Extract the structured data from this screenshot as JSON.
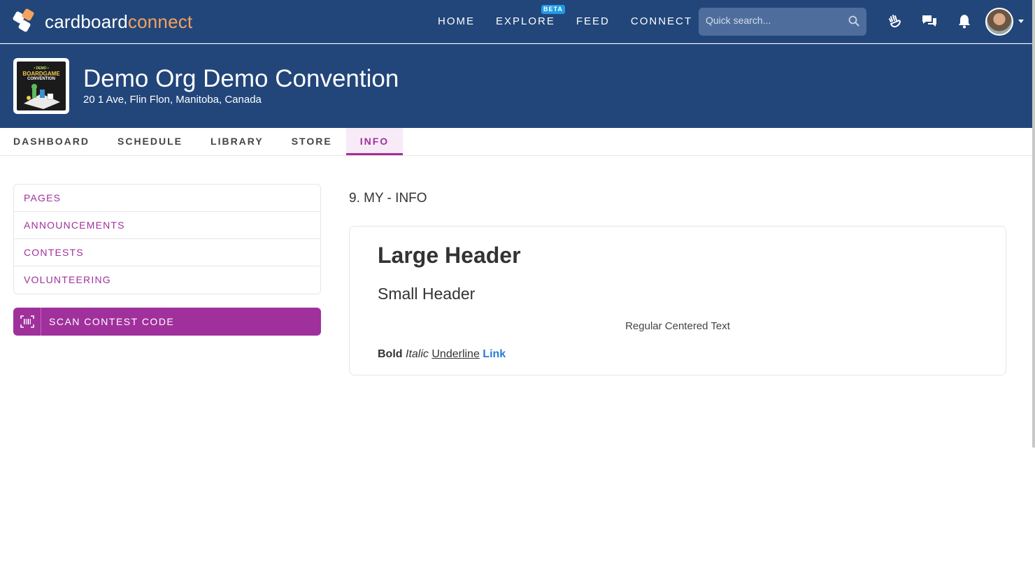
{
  "brand": {
    "part1": "cardboard",
    "part2": "connect"
  },
  "nav": {
    "items": [
      {
        "label": "HOME"
      },
      {
        "label": "EXPLORE",
        "badge": "BETA"
      },
      {
        "label": "FEED"
      },
      {
        "label": "CONNECT"
      }
    ]
  },
  "search": {
    "placeholder": "Quick search..."
  },
  "org": {
    "logo_line1": "• DEMO •",
    "logo_line2": "BOARDGAME",
    "logo_line3": "CONVENTION",
    "title": "Demo Org Demo Convention",
    "address": "20 1 Ave, Flin Flon, Manitoba, Canada"
  },
  "tabs": [
    {
      "label": "DASHBOARD"
    },
    {
      "label": "SCHEDULE"
    },
    {
      "label": "LIBRARY"
    },
    {
      "label": "STORE"
    },
    {
      "label": "INFO",
      "active": true
    }
  ],
  "sidebar": {
    "items": [
      {
        "label": "PAGES"
      },
      {
        "label": "ANNOUNCEMENTS"
      },
      {
        "label": "CONTESTS"
      },
      {
        "label": "VOLUNTEERING"
      }
    ],
    "scan_button": "SCAN CONTEST CODE"
  },
  "content": {
    "page_title": "9. MY - INFO",
    "large_header": "Large Header",
    "small_header": "Small Header",
    "centered_text": "Regular Centered Text",
    "bold": "Bold",
    "italic": "Italic",
    "underline": "Underline",
    "link": "Link"
  },
  "colors": {
    "header_bg": "#22467a",
    "accent": "#a0309c",
    "brand_orange": "#f5a25d",
    "link": "#2a7ad8"
  }
}
